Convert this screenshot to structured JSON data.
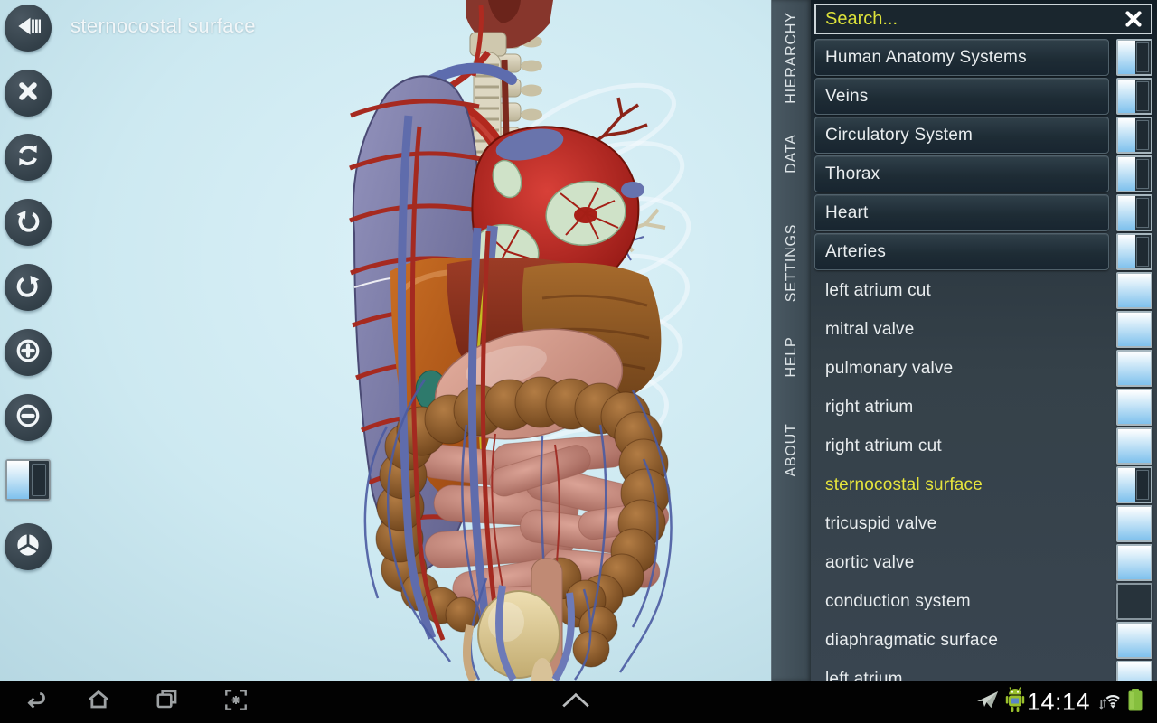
{
  "app": {
    "selected_structure": "sternocostal surface"
  },
  "toolbar": {
    "buttons": [
      {
        "name": "back-button",
        "icon": "back-icon"
      },
      {
        "name": "close-model-button",
        "icon": "close-icon"
      },
      {
        "name": "refresh-button",
        "icon": "refresh-icon"
      },
      {
        "name": "rotate-left-button",
        "icon": "rotate-left-icon"
      },
      {
        "name": "rotate-right-button",
        "icon": "rotate-right-icon"
      },
      {
        "name": "zoom-in-button",
        "icon": "zoom-in-icon"
      },
      {
        "name": "zoom-out-button",
        "icon": "zoom-out-icon"
      },
      {
        "name": "layer-visibility-toggle",
        "icon": "half-toggle",
        "state": "half"
      },
      {
        "name": "sphere-view-button",
        "icon": "sphere-icon"
      }
    ]
  },
  "side_tabs": [
    {
      "label": "HIERARCHY"
    },
    {
      "label": "DATA"
    },
    {
      "label": "SETTINGS"
    },
    {
      "label": "HELP"
    },
    {
      "label": "ABOUT"
    }
  ],
  "hierarchy_panel": {
    "search_placeholder": "Search...",
    "close_icon": "close-panel-icon",
    "items": [
      {
        "label": "Human Anatomy Systems",
        "kind": "group",
        "check": "half"
      },
      {
        "label": "Veins",
        "kind": "group",
        "check": "half"
      },
      {
        "label": "Circulatory System",
        "kind": "group",
        "check": "half"
      },
      {
        "label": "Thorax",
        "kind": "group",
        "check": "half"
      },
      {
        "label": "Heart",
        "kind": "group",
        "check": "half"
      },
      {
        "label": "Arteries",
        "kind": "group",
        "check": "half"
      },
      {
        "label": "left atrium cut",
        "kind": "leaf",
        "check": "full"
      },
      {
        "label": "mitral valve",
        "kind": "leaf",
        "check": "full"
      },
      {
        "label": "pulmonary valve",
        "kind": "leaf",
        "check": "full"
      },
      {
        "label": "right atrium",
        "kind": "leaf",
        "check": "full"
      },
      {
        "label": "right atrium cut",
        "kind": "leaf",
        "check": "full"
      },
      {
        "label": "sternocostal surface",
        "kind": "leaf",
        "check": "half",
        "highlighted": true
      },
      {
        "label": "tricuspid valve",
        "kind": "leaf",
        "check": "full"
      },
      {
        "label": "aortic valve",
        "kind": "leaf",
        "check": "full"
      },
      {
        "label": "conduction system",
        "kind": "leaf",
        "check": "empty"
      },
      {
        "label": "diaphragmatic surface",
        "kind": "leaf",
        "check": "full"
      },
      {
        "label": "left atrium",
        "kind": "leaf",
        "check": "full"
      }
    ]
  },
  "navbar": {
    "time": "14:14",
    "left_buttons": [
      {
        "name": "nav-back-button",
        "icon": "nav-back-icon"
      },
      {
        "name": "nav-home-button",
        "icon": "nav-home-icon"
      },
      {
        "name": "nav-recents-button",
        "icon": "nav-recents-icon"
      },
      {
        "name": "nav-screenshot-button",
        "icon": "nav-screenshot-icon"
      }
    ],
    "center_button": {
      "name": "tray-expand-button",
      "icon": "chevron-up-icon"
    },
    "status_left_icons": [
      {
        "name": "notification-plane-icon",
        "icon": "plane-icon"
      },
      {
        "name": "android-update-icon",
        "icon": "android-icon"
      }
    ],
    "status_right_icons": [
      {
        "name": "wifi-signal-icon",
        "icon": "wifi-icon"
      },
      {
        "name": "battery-icon",
        "icon": "battery-icon"
      }
    ]
  },
  "colors": {
    "highlight_yellow": "#e6e43c",
    "check_blue": "#7fc1ed",
    "panel_dark": "#1b2730",
    "tabstrip": "#43525c",
    "battery_green": "#86bf3e",
    "canvas_blue": "#cde9f1"
  }
}
